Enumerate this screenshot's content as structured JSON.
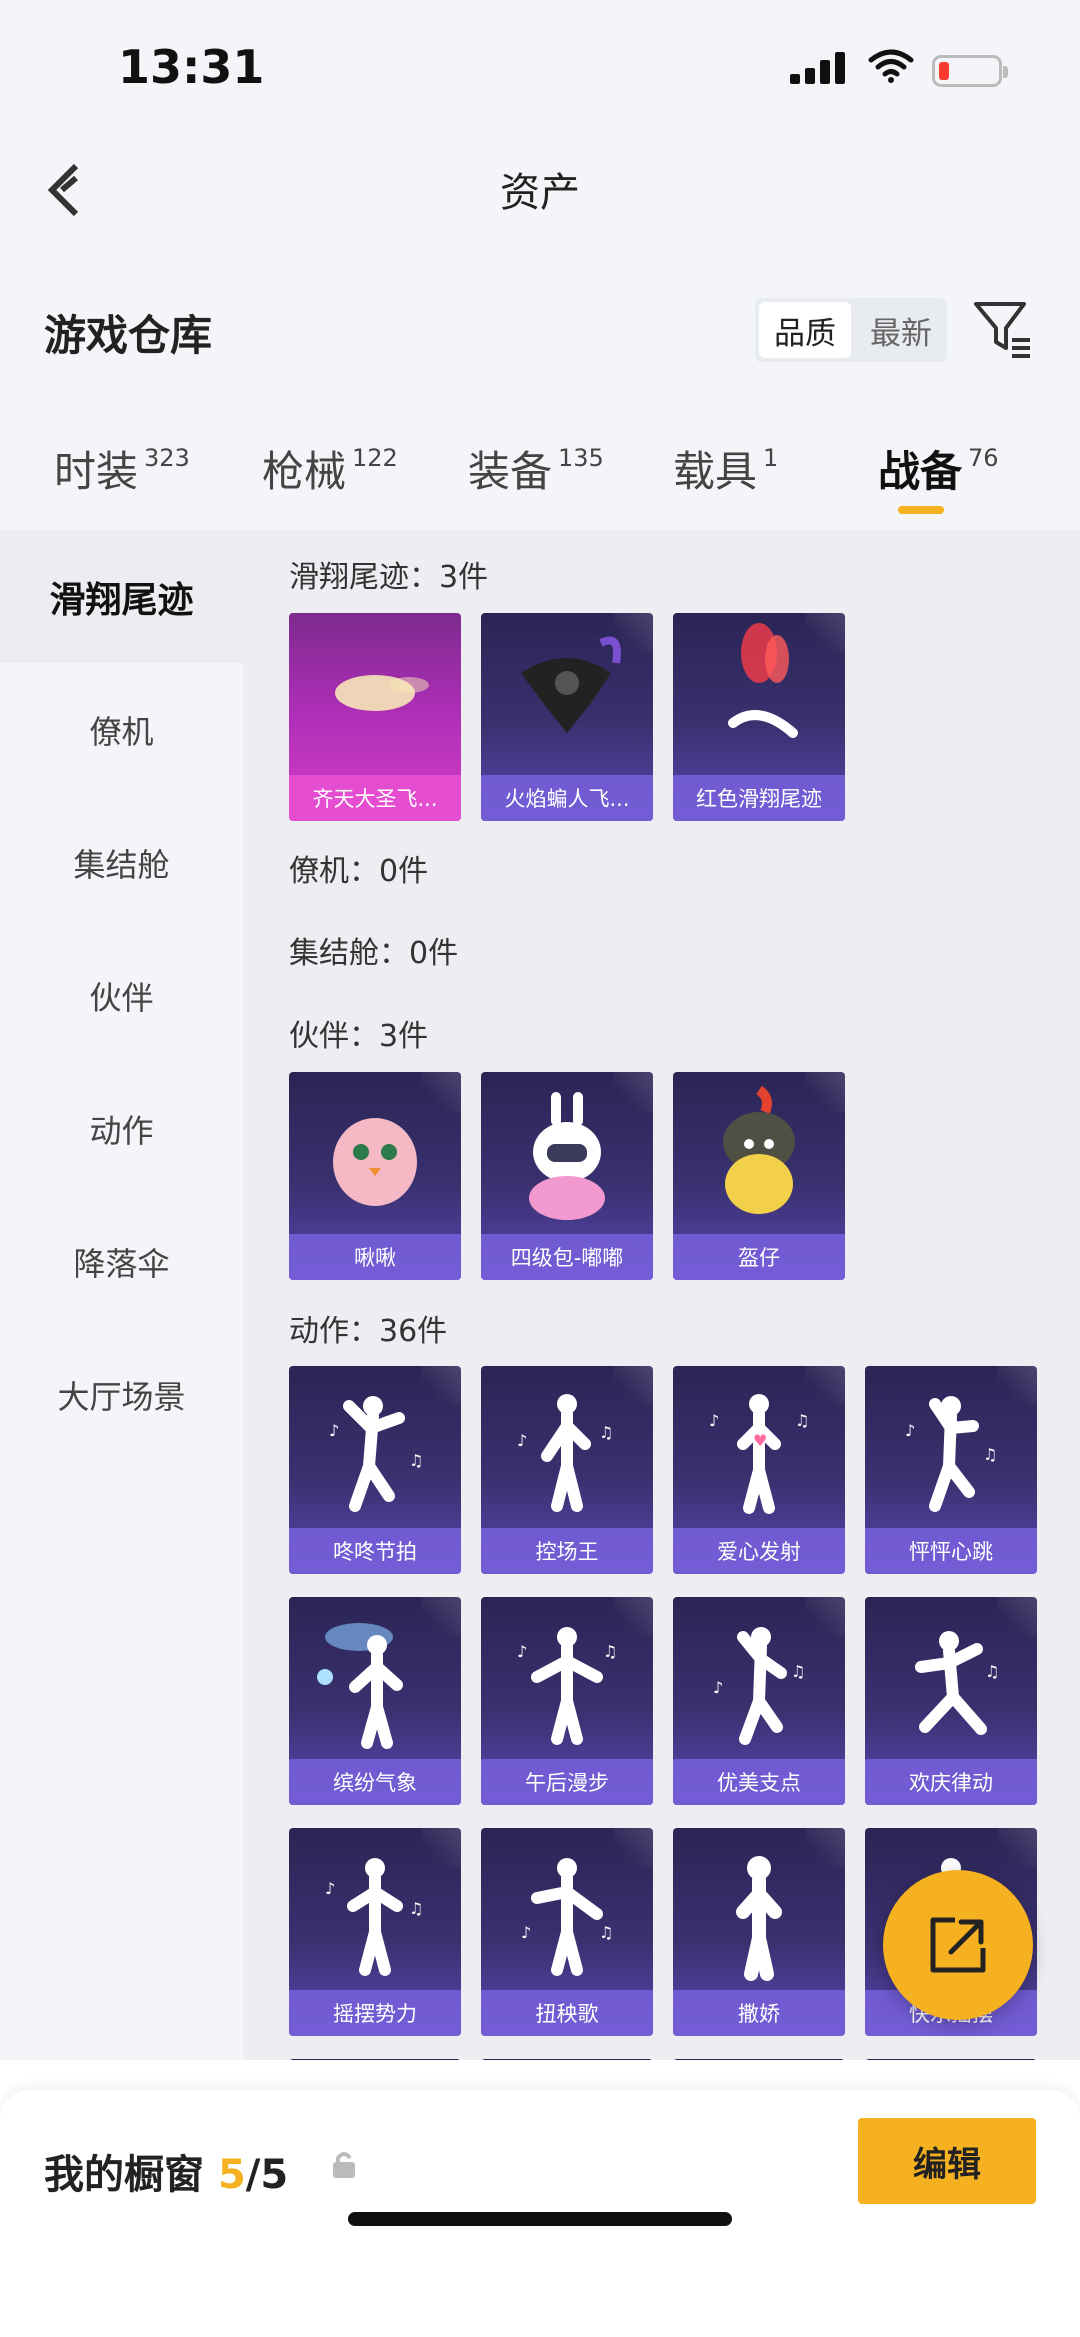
{
  "status_bar": {
    "time": "13:31"
  },
  "header": {
    "title": "资产"
  },
  "warehouse": {
    "title": "游戏仓库",
    "sort_options": [
      "品质",
      "最新"
    ]
  },
  "tabs": [
    {
      "label": "时装",
      "count": "323"
    },
    {
      "label": "枪械",
      "count": "122"
    },
    {
      "label": "装备",
      "count": "135"
    },
    {
      "label": "载具",
      "count": "1"
    },
    {
      "label": "战备",
      "count": "76"
    }
  ],
  "sidebar": {
    "items": [
      "滑翔尾迹",
      "僚机",
      "集结舱",
      "伙伴",
      "动作",
      "降落伞",
      "大厅场景"
    ]
  },
  "sections": {
    "trails": {
      "title": "滑翔尾迹：3件",
      "items": [
        "齐天大圣飞...",
        "火焰蝙人飞...",
        "红色滑翔尾迹"
      ]
    },
    "wingman": {
      "title": "僚机：0件"
    },
    "assembly": {
      "title": "集结舱：0件"
    },
    "partner": {
      "title": "伙伴：3件",
      "items": [
        "啾啾",
        "四级包-嘟嘟",
        "盔仔"
      ]
    },
    "emotes": {
      "title": "动作：36件",
      "items": [
        "咚咚节拍",
        "控场王",
        "爱心发射",
        "怦怦心跳",
        "缤纷气象",
        "午后漫步",
        "优美支点",
        "欢庆律动",
        "摇摆势力",
        "扭秧歌",
        "撒娇",
        "快乐摇摆"
      ]
    }
  },
  "showcase": {
    "label": "我的橱窗",
    "current": "5",
    "total": "/5"
  },
  "edit_button": "编辑",
  "colors": {
    "accent": "#f5b120",
    "card_bg": "#3a3170",
    "card_label": "#7860dc"
  }
}
